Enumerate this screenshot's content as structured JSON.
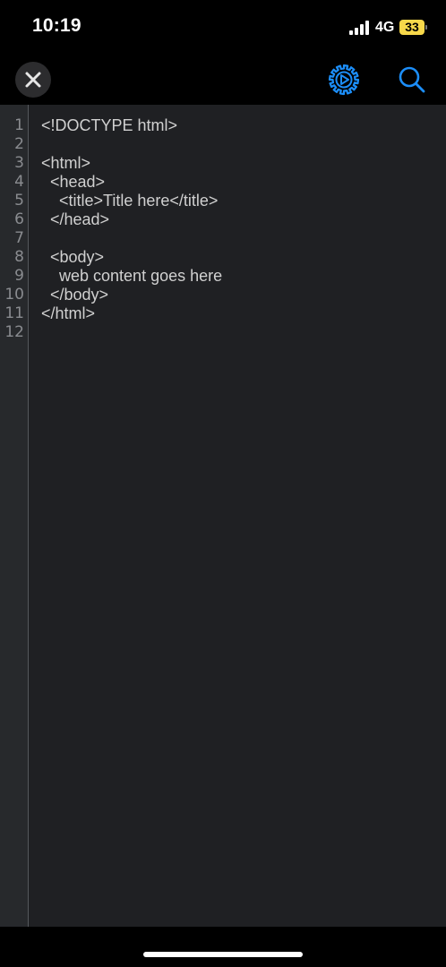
{
  "status_bar": {
    "time": "10:19",
    "network": "4G",
    "battery": "33",
    "battery_color": "#f7d84a"
  },
  "toolbar": {
    "close_icon": "close-icon",
    "settings_icon": "gear-icon",
    "search_icon": "search-icon",
    "accent_color": "#1c8ef9"
  },
  "editor": {
    "lines": [
      {
        "number": "1",
        "text": "<!DOCTYPE html>"
      },
      {
        "number": "2",
        "text": ""
      },
      {
        "number": "3",
        "text": "<html>"
      },
      {
        "number": "4",
        "text": "  <head>"
      },
      {
        "number": "5",
        "text": "    <title>Title here</title>"
      },
      {
        "number": "6",
        "text": "  </head>"
      },
      {
        "number": "7",
        "text": ""
      },
      {
        "number": "8",
        "text": "  <body>"
      },
      {
        "number": "9",
        "text": "    web content goes here"
      },
      {
        "number": "10",
        "text": "  </body>"
      },
      {
        "number": "11",
        "text": "</html>"
      },
      {
        "number": "12",
        "text": ""
      }
    ]
  }
}
